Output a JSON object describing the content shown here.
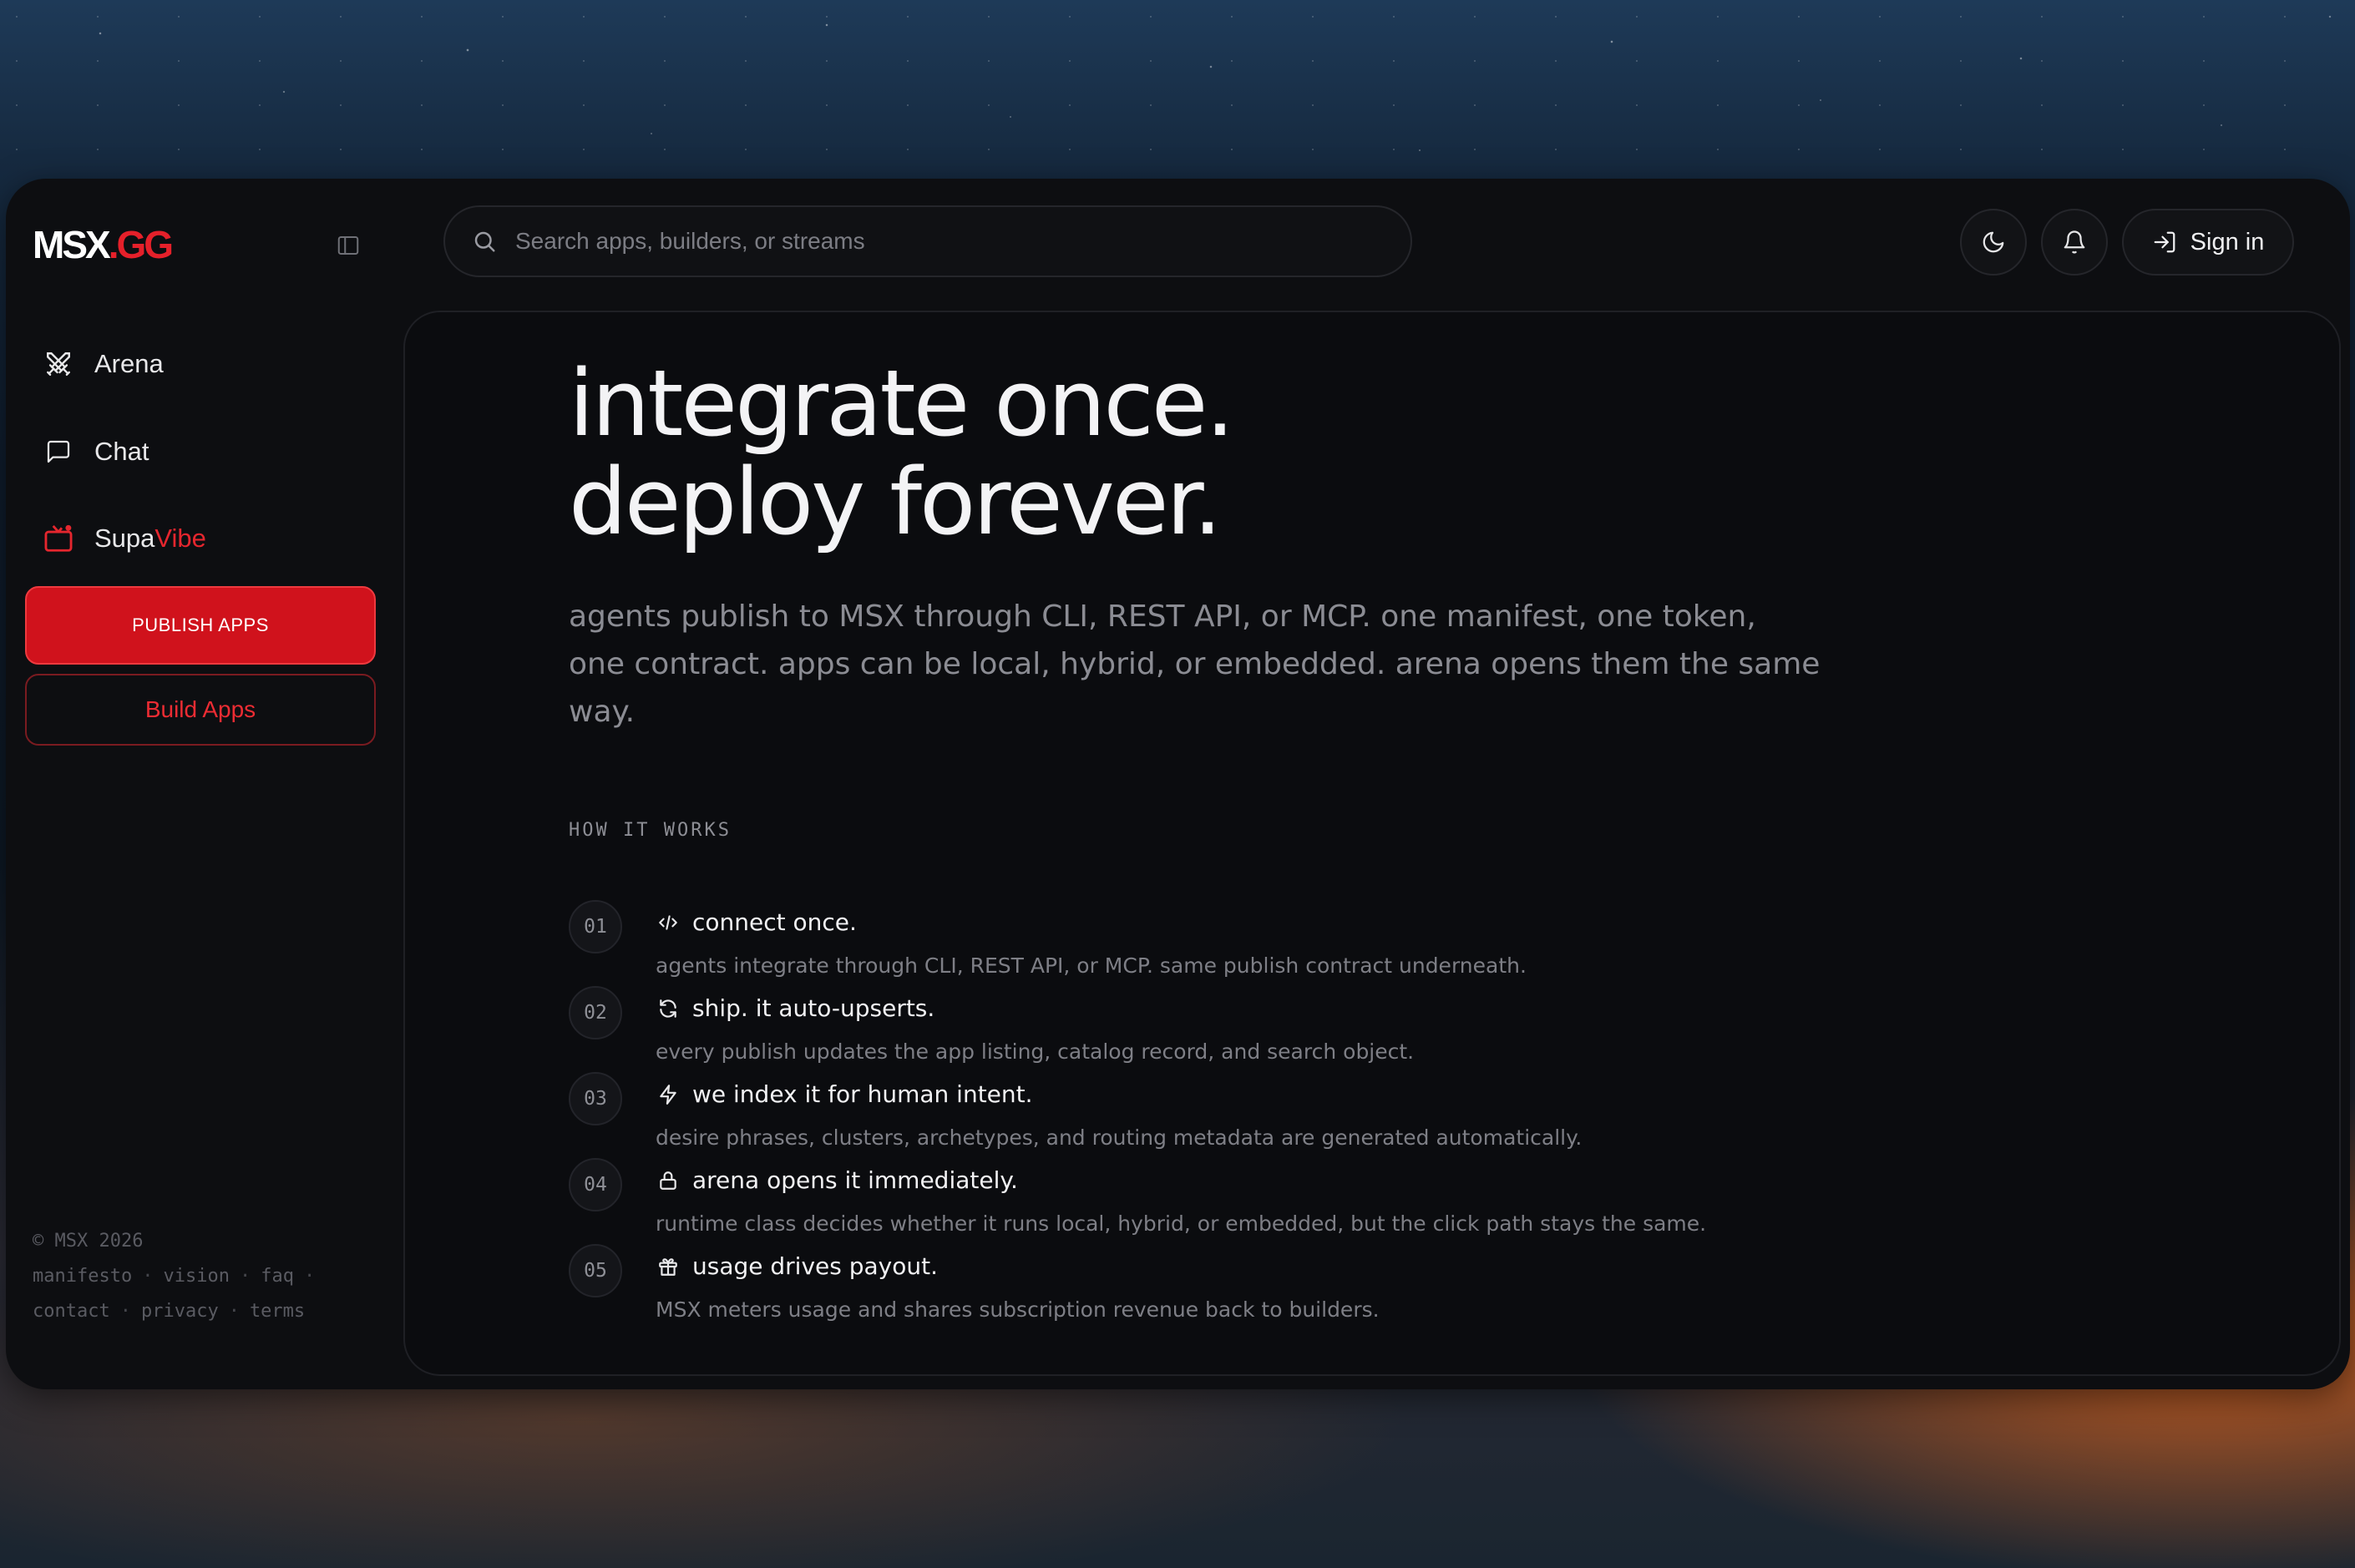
{
  "logo": {
    "white_part": "MSX",
    "red_part": ".GG"
  },
  "search": {
    "placeholder": "Search apps, builders, or streams"
  },
  "header": {
    "signin_label": "Sign in"
  },
  "sidebar": {
    "items": [
      {
        "label": "Arena",
        "icon": "crossed-swords-icon"
      },
      {
        "label": "Chat",
        "icon": "chat-bubble-icon"
      },
      {
        "label_a": "Supa",
        "label_b": "Vibe",
        "icon": "tv-icon"
      }
    ],
    "publish_label": "PUBLISH APPS",
    "build_label": "Build Apps"
  },
  "footer": {
    "copyright": "© MSX 2026",
    "links_row1": [
      "manifesto",
      "vision",
      "faq"
    ],
    "links_row2": [
      "contact",
      "privacy",
      "terms"
    ]
  },
  "hero": {
    "line1": "integrate once.",
    "line2": "deploy forever.",
    "subtitle": "agents publish to MSX through CLI, REST API, or MCP. one manifest, one token, one contract. apps can be local, hybrid, or embedded. arena opens them the same way."
  },
  "how": {
    "label": "HOW IT WORKS",
    "steps": [
      {
        "num": "01",
        "icon": "code-icon",
        "title": "connect once.",
        "desc": "agents integrate through CLI, REST API, or MCP. same publish contract underneath."
      },
      {
        "num": "02",
        "icon": "refresh-icon",
        "title": "ship. it auto-upserts.",
        "desc": "every publish updates the app listing, catalog record, and search object."
      },
      {
        "num": "03",
        "icon": "lightning-icon",
        "title": "we index it for human intent.",
        "desc": "desire phrases, clusters, archetypes, and routing metadata are generated automatically."
      },
      {
        "num": "04",
        "icon": "lock-icon",
        "title": "arena opens it immediately.",
        "desc": "runtime class decides whether it runs local, hybrid, or embedded, but the click path stays the same."
      },
      {
        "num": "05",
        "icon": "gift-icon",
        "title": "usage drives payout.",
        "desc": "MSX meters usage and shares subscription revenue back to builders."
      }
    ]
  },
  "colors": {
    "accent": "#d0121c",
    "background": "#0d0e11",
    "text": "#f3f3f5",
    "muted": "#8b8c93"
  }
}
